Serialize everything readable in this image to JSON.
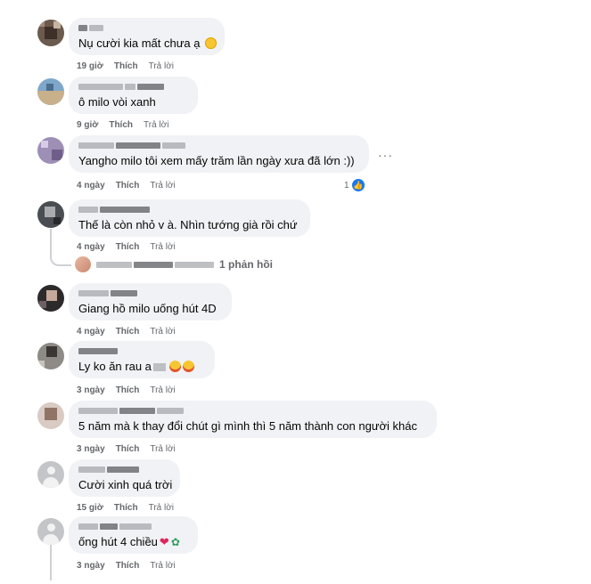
{
  "comments": [
    {
      "text": "Nụ cười kia mất chưa ạ",
      "time": "19 giờ",
      "like": "Thích",
      "reply": "Trả lời",
      "emoji": "face-emoji"
    },
    {
      "text": "ô milo vòi xanh",
      "time": "9 giờ",
      "like": "Thích",
      "reply": "Trả lời"
    },
    {
      "text": "Yangho milo tôi xem mấy trăm lần ngày xưa đã lớn :))",
      "time": "4 ngày",
      "like": "Thích",
      "reply": "Trả lời",
      "reaction_count": "1"
    },
    {
      "text": "Thế là còn nhỏ v à. Nhìn tướng già rồi chứ",
      "time": "4 ngày",
      "like": "Thích",
      "reply": "Trả lời",
      "replies_label": "1 phản hồi"
    },
    {
      "text": "Giang hồ milo uống hút 4D",
      "time": "4 ngày",
      "like": "Thích",
      "reply": "Trả lời"
    },
    {
      "text": "Ly ko ăn rau a",
      "time": "3 ngày",
      "like": "Thích",
      "reply": "Trả lời"
    },
    {
      "text": "5 năm mà k thay đổi chút gì mình thì 5 năm thành con người khác",
      "time": "3 ngày",
      "like": "Thích",
      "reply": "Trả lời"
    },
    {
      "text": "Cười xinh quá trời",
      "time": "15 giờ",
      "like": "Thích",
      "reply": "Trả lời"
    },
    {
      "text": "ống hút 4 chiều",
      "time": "3 ngày",
      "like": "Thích",
      "reply": "Trả lời"
    }
  ],
  "icons": {
    "more": "more-options-icon",
    "like_badge": "like-thumb-icon"
  },
  "colors": {
    "bubble": "#f0f2f5",
    "meta": "#65676b",
    "like": "#1877f2"
  }
}
